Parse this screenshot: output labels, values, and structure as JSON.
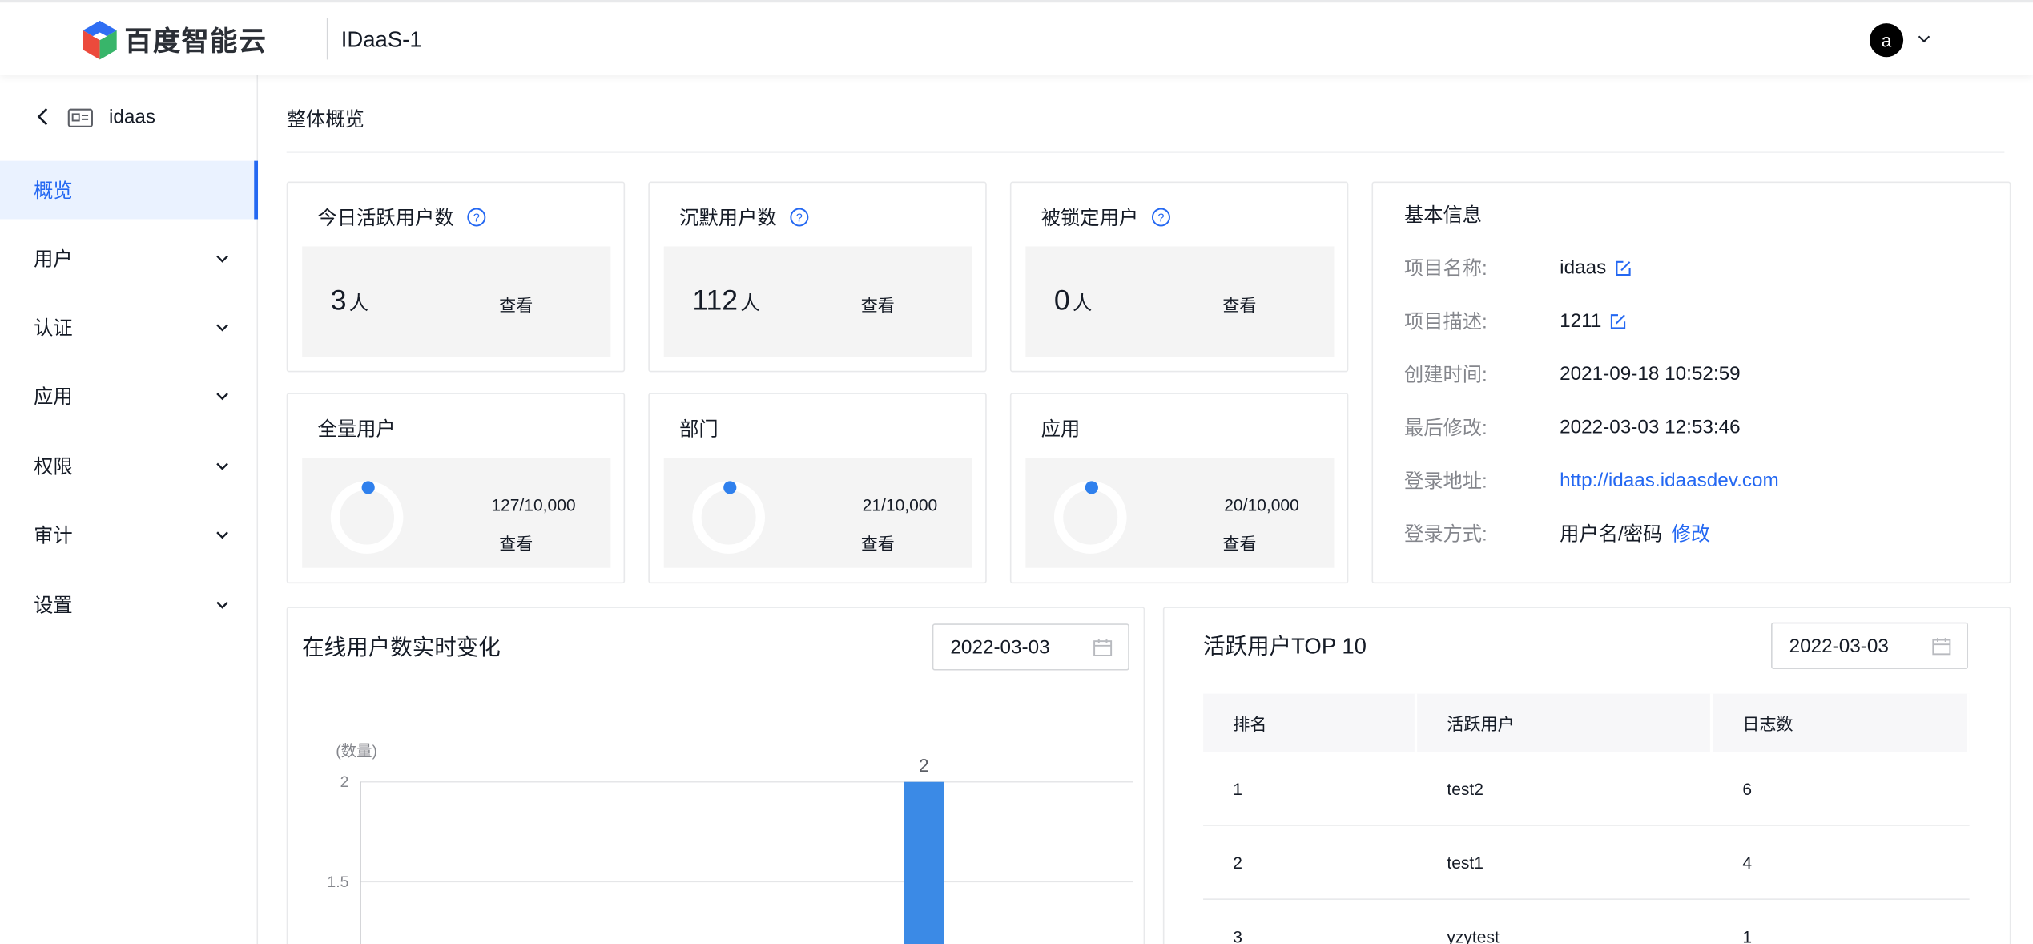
{
  "header": {
    "logo_text": "百度智能云",
    "app_title": "IDaaS-1",
    "avatar_letter": "a"
  },
  "sidebar": {
    "project_name": "idaas",
    "items": [
      {
        "label": "概览",
        "active": true,
        "has_children": false
      },
      {
        "label": "用户",
        "active": false,
        "has_children": true
      },
      {
        "label": "认证",
        "active": false,
        "has_children": true
      },
      {
        "label": "应用",
        "active": false,
        "has_children": true
      },
      {
        "label": "权限",
        "active": false,
        "has_children": true
      },
      {
        "label": "审计",
        "active": false,
        "has_children": true
      },
      {
        "label": "设置",
        "active": false,
        "has_children": true
      }
    ]
  },
  "page": {
    "title": "整体概览"
  },
  "stats": [
    {
      "title": "今日活跃用户数",
      "value": "3",
      "unit": "人",
      "view": "查看"
    },
    {
      "title": "沉默用户数",
      "value": "112",
      "unit": "人",
      "view": "查看"
    },
    {
      "title": "被锁定用户",
      "value": "0",
      "unit": "人",
      "view": "查看"
    }
  ],
  "quotas": [
    {
      "title": "全量用户",
      "ratio": "127/10,000",
      "view": "查看",
      "used_fraction": 0.0127
    },
    {
      "title": "部门",
      "ratio": "21/10,000",
      "view": "查看",
      "used_fraction": 0.0021
    },
    {
      "title": "应用",
      "ratio": "20/10,000",
      "view": "查看",
      "used_fraction": 0.002
    }
  ],
  "info": {
    "title": "基本信息",
    "name_label": "项目名称:",
    "name_value": "idaas",
    "desc_label": "项目描述:",
    "desc_value": "1211",
    "created_label": "创建时间:",
    "created_value": "2021-09-18 10:52:59",
    "modified_label": "最后修改:",
    "modified_value": "2022-03-03 12:53:46",
    "url_label": "登录地址:",
    "url_value": "http://idaas.idaasdev.com",
    "method_label": "登录方式:",
    "method_value": "用户名/密码",
    "method_edit": "修改"
  },
  "online_chart": {
    "title": "在线用户数实时变化",
    "date": "2022-03-03"
  },
  "chart_data": {
    "type": "bar",
    "ylabel": "(数量)",
    "y_ticks": [
      "2",
      "1.5"
    ],
    "ylim": [
      1.5,
      2
    ],
    "bars": [
      {
        "value": 2,
        "label": "2"
      }
    ]
  },
  "top10": {
    "title": "活跃用户TOP 10",
    "date": "2022-03-03",
    "columns": [
      "排名",
      "活跃用户",
      "日志数"
    ],
    "rows": [
      [
        "1",
        "test2",
        "6"
      ],
      [
        "2",
        "test1",
        "4"
      ],
      [
        "3",
        "yzytest",
        "1"
      ]
    ]
  },
  "colors": {
    "accent": "#2468f2",
    "bar": "#3b8ae6",
    "active_bg": "#eaf2ff"
  }
}
